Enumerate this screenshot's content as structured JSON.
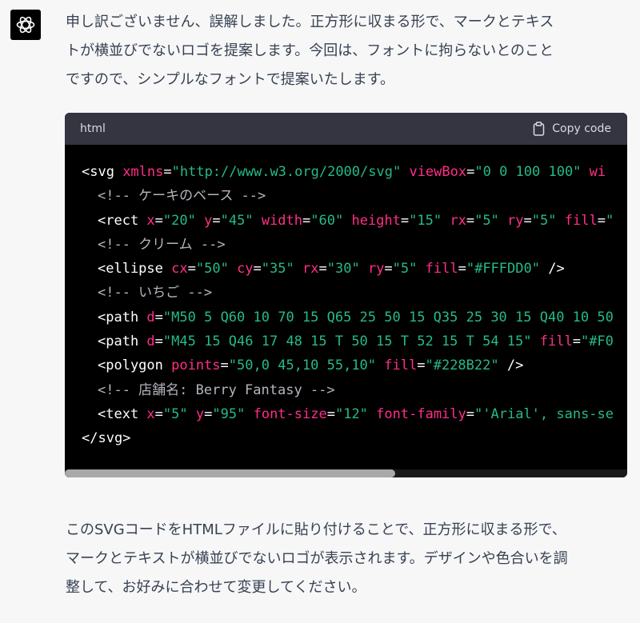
{
  "assistant": {
    "avatar_icon": "openai-logo-icon",
    "intro_lines": [
      "申し訳ございません、誤解しました。正方形に収まる形で、マークとテキス",
      "トが横並びでないロゴを提案します。今回は、フォントに拘らないとのこと",
      "ですので、シンプルなフォントで提案いたします。"
    ],
    "outro_lines": [
      "このSVGコードをHTMLファイルに貼り付けることで、正方形に収まる形で、",
      "マークとテキストが横並びでないロゴが表示されます。デザインや色合いを調",
      "整して、お好みに合わせて変更してください。"
    ]
  },
  "code_block": {
    "language": "html",
    "copy_label": "Copy code",
    "copy_icon": "clipboard-icon",
    "lines": [
      {
        "indent": false,
        "tokens": [
          {
            "t": "tag",
            "v": "<svg "
          },
          {
            "t": "attr",
            "v": "xmlns"
          },
          {
            "t": "tag",
            "v": "="
          },
          {
            "t": "str",
            "v": "\"http://www.w3.org/2000/svg\""
          },
          {
            "t": "tag",
            "v": " "
          },
          {
            "t": "attr",
            "v": "viewBox"
          },
          {
            "t": "tag",
            "v": "="
          },
          {
            "t": "str",
            "v": "\"0 0 100 100\""
          },
          {
            "t": "tag",
            "v": " "
          },
          {
            "t": "attr",
            "v": "wi"
          }
        ]
      },
      {
        "indent": true,
        "tokens": [
          {
            "t": "cmt",
            "v": "<!-- ケーキのベース -->"
          }
        ]
      },
      {
        "indent": true,
        "tokens": [
          {
            "t": "tag",
            "v": "<rect "
          },
          {
            "t": "attr",
            "v": "x"
          },
          {
            "t": "tag",
            "v": "="
          },
          {
            "t": "str",
            "v": "\"20\""
          },
          {
            "t": "tag",
            "v": " "
          },
          {
            "t": "attr",
            "v": "y"
          },
          {
            "t": "tag",
            "v": "="
          },
          {
            "t": "str",
            "v": "\"45\""
          },
          {
            "t": "tag",
            "v": " "
          },
          {
            "t": "attr",
            "v": "width"
          },
          {
            "t": "tag",
            "v": "="
          },
          {
            "t": "str",
            "v": "\"60\""
          },
          {
            "t": "tag",
            "v": " "
          },
          {
            "t": "attr",
            "v": "height"
          },
          {
            "t": "tag",
            "v": "="
          },
          {
            "t": "str",
            "v": "\"15\""
          },
          {
            "t": "tag",
            "v": " "
          },
          {
            "t": "attr",
            "v": "rx"
          },
          {
            "t": "tag",
            "v": "="
          },
          {
            "t": "str",
            "v": "\"5\""
          },
          {
            "t": "tag",
            "v": " "
          },
          {
            "t": "attr",
            "v": "ry"
          },
          {
            "t": "tag",
            "v": "="
          },
          {
            "t": "str",
            "v": "\"5\""
          },
          {
            "t": "tag",
            "v": " "
          },
          {
            "t": "attr",
            "v": "fill"
          },
          {
            "t": "tag",
            "v": "="
          },
          {
            "t": "str",
            "v": "\""
          }
        ]
      },
      {
        "indent": true,
        "tokens": [
          {
            "t": "cmt",
            "v": "<!-- クリーム -->"
          }
        ]
      },
      {
        "indent": true,
        "tokens": [
          {
            "t": "tag",
            "v": "<ellipse "
          },
          {
            "t": "attr",
            "v": "cx"
          },
          {
            "t": "tag",
            "v": "="
          },
          {
            "t": "str",
            "v": "\"50\""
          },
          {
            "t": "tag",
            "v": " "
          },
          {
            "t": "attr",
            "v": "cy"
          },
          {
            "t": "tag",
            "v": "="
          },
          {
            "t": "str",
            "v": "\"35\""
          },
          {
            "t": "tag",
            "v": " "
          },
          {
            "t": "attr",
            "v": "rx"
          },
          {
            "t": "tag",
            "v": "="
          },
          {
            "t": "str",
            "v": "\"30\""
          },
          {
            "t": "tag",
            "v": " "
          },
          {
            "t": "attr",
            "v": "ry"
          },
          {
            "t": "tag",
            "v": "="
          },
          {
            "t": "str",
            "v": "\"5\""
          },
          {
            "t": "tag",
            "v": " "
          },
          {
            "t": "attr",
            "v": "fill"
          },
          {
            "t": "tag",
            "v": "="
          },
          {
            "t": "str",
            "v": "\"#FFFDD0\""
          },
          {
            "t": "tag",
            "v": " />"
          }
        ]
      },
      {
        "indent": true,
        "tokens": [
          {
            "t": "cmt",
            "v": "<!-- いちご -->"
          }
        ]
      },
      {
        "indent": true,
        "tokens": [
          {
            "t": "tag",
            "v": "<path "
          },
          {
            "t": "attr",
            "v": "d"
          },
          {
            "t": "tag",
            "v": "="
          },
          {
            "t": "str",
            "v": "\"M50 5 Q60 10 70 15 Q65 25 50 15 Q35 25 30 15 Q40 10 50"
          }
        ]
      },
      {
        "indent": true,
        "tokens": [
          {
            "t": "tag",
            "v": "<path "
          },
          {
            "t": "attr",
            "v": "d"
          },
          {
            "t": "tag",
            "v": "="
          },
          {
            "t": "str",
            "v": "\"M45 15 Q46 17 48 15 T 50 15 T 52 15 T 54 15\""
          },
          {
            "t": "tag",
            "v": " "
          },
          {
            "t": "attr",
            "v": "fill"
          },
          {
            "t": "tag",
            "v": "="
          },
          {
            "t": "str",
            "v": "\"#F0"
          }
        ]
      },
      {
        "indent": true,
        "tokens": [
          {
            "t": "tag",
            "v": "<polygon "
          },
          {
            "t": "attr",
            "v": "points"
          },
          {
            "t": "tag",
            "v": "="
          },
          {
            "t": "str",
            "v": "\"50,0 45,10 55,10\""
          },
          {
            "t": "tag",
            "v": " "
          },
          {
            "t": "attr",
            "v": "fill"
          },
          {
            "t": "tag",
            "v": "="
          },
          {
            "t": "str",
            "v": "\"#228B22\""
          },
          {
            "t": "tag",
            "v": " />"
          }
        ]
      },
      {
        "indent": true,
        "tokens": [
          {
            "t": "cmt",
            "v": "<!-- 店舗名: Berry Fantasy -->"
          }
        ]
      },
      {
        "indent": true,
        "tokens": [
          {
            "t": "tag",
            "v": "<text "
          },
          {
            "t": "attr",
            "v": "x"
          },
          {
            "t": "tag",
            "v": "="
          },
          {
            "t": "str",
            "v": "\"5\""
          },
          {
            "t": "tag",
            "v": " "
          },
          {
            "t": "attr",
            "v": "y"
          },
          {
            "t": "tag",
            "v": "="
          },
          {
            "t": "str",
            "v": "\"95\""
          },
          {
            "t": "tag",
            "v": " "
          },
          {
            "t": "attr",
            "v": "font-size"
          },
          {
            "t": "tag",
            "v": "="
          },
          {
            "t": "str",
            "v": "\"12\""
          },
          {
            "t": "tag",
            "v": " "
          },
          {
            "t": "attr",
            "v": "font-family"
          },
          {
            "t": "tag",
            "v": "="
          },
          {
            "t": "str",
            "v": "\"'Arial', sans-se"
          }
        ]
      },
      {
        "indent": false,
        "tokens": [
          {
            "t": "tag",
            "v": "</svg>"
          }
        ]
      }
    ]
  },
  "colors": {
    "page_background": "#f7f7f8",
    "text": "#374151",
    "code_header": "#343541",
    "code_background": "#000000",
    "token_attribute": "#ff2e88",
    "token_string": "#26b98a",
    "token_comment": "#b4b4bd"
  }
}
